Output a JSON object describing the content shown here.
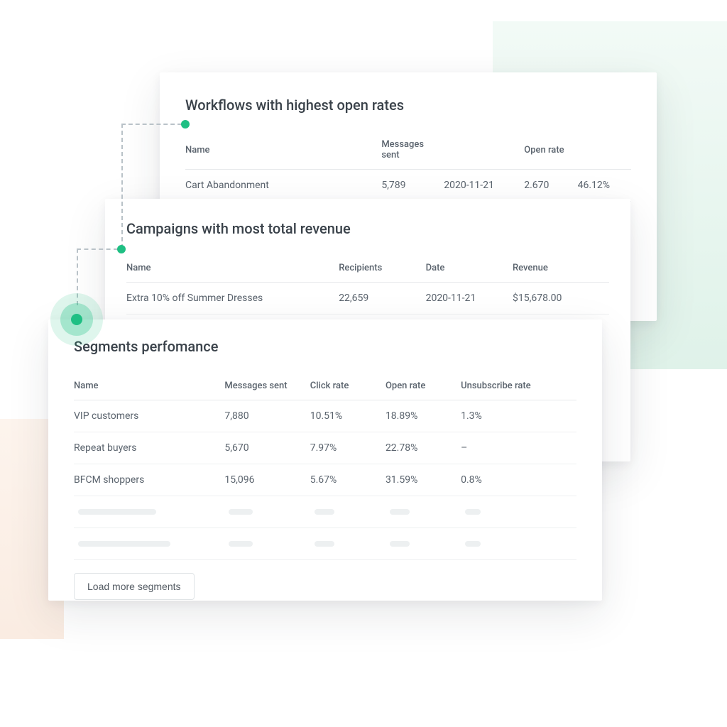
{
  "workflows": {
    "title": "Workflows with highest open rates",
    "headers": {
      "name": "Name",
      "messages": "Messages sent",
      "open": "Open rate"
    },
    "rows": [
      {
        "name": "Cart Abandonment",
        "messages": "5,789",
        "date": "2020-11-21",
        "open": "2.670",
        "pct": "46.12%"
      }
    ]
  },
  "campaigns": {
    "title": "Campaigns with most total revenue",
    "headers": {
      "name": "Name",
      "recipients": "Recipients",
      "date": "Date",
      "revenue": "Revenue"
    },
    "rows": [
      {
        "name": "Extra 10% off Summer Dresses",
        "recipients": "22,659",
        "date": "2020-11-21",
        "revenue": "$15,678.00"
      }
    ]
  },
  "segments": {
    "title": "Segments perfomance",
    "headers": {
      "name": "Name",
      "messages": "Messages sent",
      "click": "Click rate",
      "open": "Open rate",
      "unsub": "Unsubscribe rate"
    },
    "rows": [
      {
        "name": "VIP customers",
        "messages": "7,880",
        "click": "10.51%",
        "open": "18.89%",
        "unsub": "1.3%"
      },
      {
        "name": "Repeat buyers",
        "messages": "5,670",
        "click": "7.97%",
        "open": "22.78%",
        "unsub": "–"
      },
      {
        "name": "BFCM shoppers",
        "messages": "15,096",
        "click": "5.67%",
        "open": "31.59%",
        "unsub": "0.8%"
      }
    ],
    "load_more_label": "Load more segments"
  }
}
